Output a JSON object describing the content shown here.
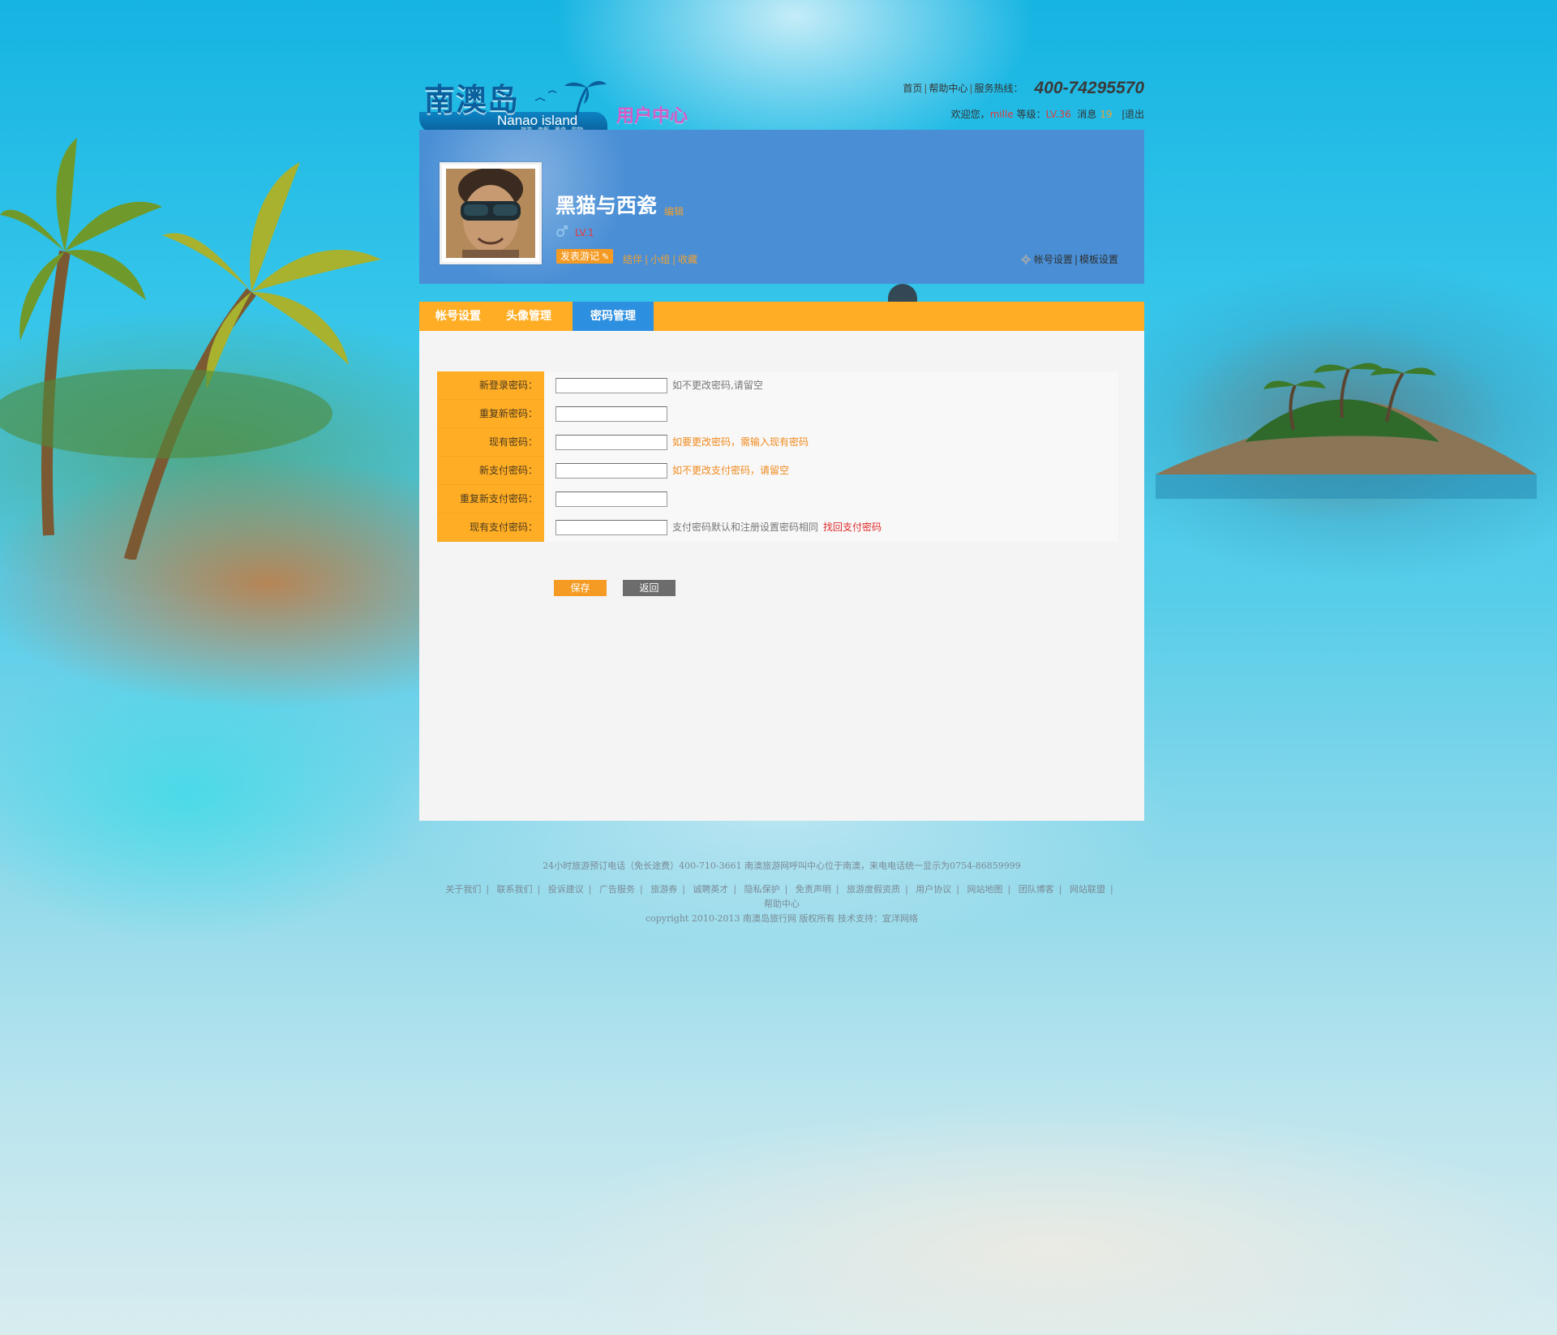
{
  "header": {
    "logo_cn": "南澳岛",
    "logo_en": "Nanao island",
    "logo_sub": "旅游，度假，美食，购物",
    "section_title": "用户中心",
    "nav_links": [
      "首页",
      "帮助中心",
      "服务热线："
    ],
    "hotline": "400-74295570",
    "welcome_prefix": "欢迎您，",
    "username": "mille",
    "level_label": "等级：",
    "level_value": "LV.36",
    "message_label": "消息",
    "message_count": "19",
    "logout": "|退出"
  },
  "profile": {
    "display_name": "黑猫与西瓷",
    "edit_label": "编辑",
    "level": "LV.1",
    "post_button": "发表游记",
    "links": [
      "结伴",
      "小组",
      "收藏"
    ],
    "settings_links": [
      "帐号设置",
      "模板设置"
    ]
  },
  "tabs": [
    {
      "label": "帐号设置",
      "active": false
    },
    {
      "label": "头像管理",
      "active": false
    },
    {
      "label": "密码管理",
      "active": true
    }
  ],
  "form": {
    "rows": [
      {
        "label": "新登录密码：",
        "value": "",
        "hint": "如不更改密码,请留空",
        "hint_style": "gray"
      },
      {
        "label": "重复新密码：",
        "value": "",
        "hint": "",
        "hint_style": "gray"
      },
      {
        "label": "现有密码：",
        "value": "",
        "hint": "如要更改密码，需输入现有密码",
        "hint_style": "orange"
      },
      {
        "label": "新支付密码：",
        "value": "",
        "hint": "如不更改支付密码，请留空",
        "hint_style": "orange"
      },
      {
        "label": "重复新支付密码：",
        "value": "",
        "hint": "",
        "hint_style": "gray"
      },
      {
        "label": "现有支付密码：",
        "value": "",
        "hint": "支付密码默认和注册设置密码相同",
        "hint_style": "gray",
        "link": "找回支付密码"
      }
    ],
    "save_label": "保存",
    "back_label": "返回"
  },
  "footer": {
    "phone_line": "24小时旅游预订电话（免长途费）400-710-3661  南澳旅游网呼叫中心位于南澳，来电电话统一显示为0754-86859999",
    "links": [
      "关于我们",
      "联系我们",
      "投诉建议",
      "广告服务",
      "旅游券",
      "诚聘英才",
      "隐私保护",
      "免责声明",
      "旅游度假资质",
      "用户协议",
      "网站地图",
      "团队博客",
      "网站联盟",
      "帮助中心"
    ],
    "copyright": "copyright 2010-2013 南澳岛旅行网 版权所有    技术支持：宜洋网络"
  },
  "colors": {
    "accent_orange": "#ffad24",
    "profile_blue": "#4a8fd5",
    "active_tab_blue": "#2d8fe0",
    "link_red": "#e02a2a",
    "hint_orange": "#f08a1e"
  }
}
